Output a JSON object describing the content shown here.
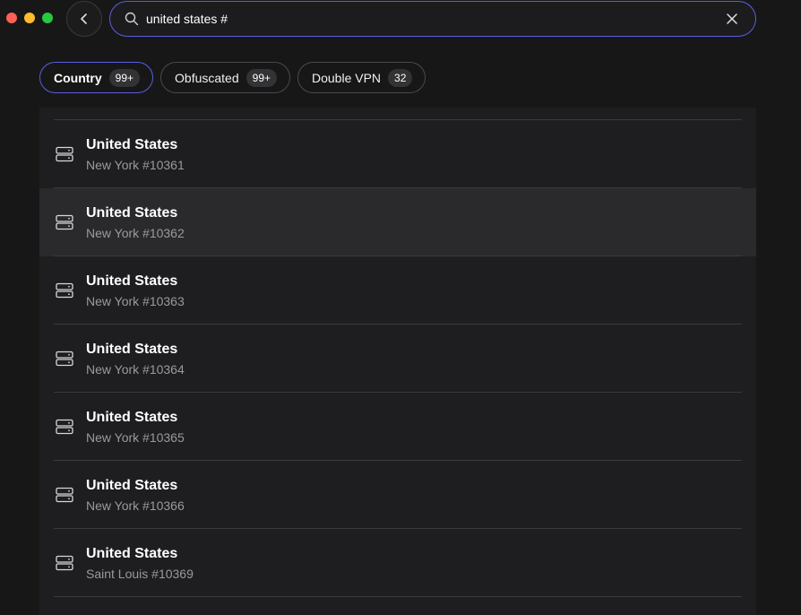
{
  "search": {
    "value": "united states #",
    "placeholder": ""
  },
  "filters": [
    {
      "label": "Country",
      "count": "99+",
      "active": true
    },
    {
      "label": "Obfuscated",
      "count": "99+",
      "active": false
    },
    {
      "label": "Double VPN",
      "count": "32",
      "active": false
    }
  ],
  "servers": [
    {
      "country": "United States",
      "server": "New York #10361"
    },
    {
      "country": "United States",
      "server": "New York #10362"
    },
    {
      "country": "United States",
      "server": "New York #10363"
    },
    {
      "country": "United States",
      "server": "New York #10364"
    },
    {
      "country": "United States",
      "server": "New York #10365"
    },
    {
      "country": "United States",
      "server": "New York #10366"
    },
    {
      "country": "United States",
      "server": "Saint Louis #10369"
    }
  ],
  "colors": {
    "accent": "#5a5fe0",
    "background": "#171717",
    "list_background": "#1e1e20",
    "hover_row": "#2a2a2c"
  }
}
